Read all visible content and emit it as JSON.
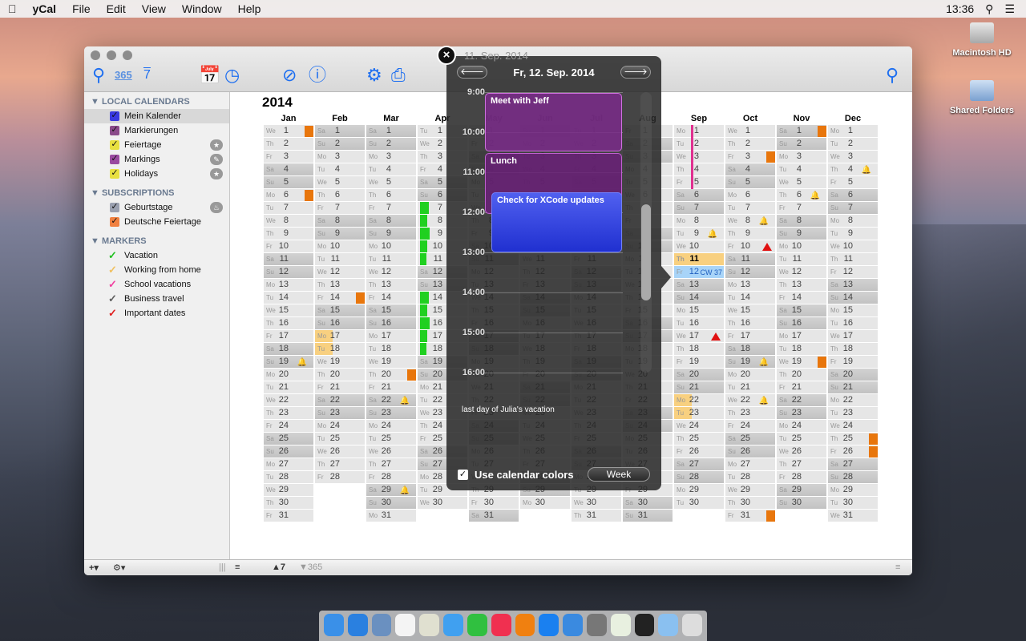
{
  "menubar": {
    "app": "yCal",
    "items": [
      "File",
      "Edit",
      "View",
      "Window",
      "Help"
    ],
    "clock": "13:36"
  },
  "desktop": [
    {
      "label": "Macintosh HD",
      "icon": "hard-drive-icon"
    },
    {
      "label": "Shared Folders",
      "icon": "network-folder-icon"
    }
  ],
  "toolbar": {
    "icons": [
      "location-icon",
      "year-view-365-icon",
      "week-view-7-icon",
      "new-event-icon",
      "new-reminder-icon",
      "edit-icon",
      "info-icon",
      "settings-gear-icon",
      "print-icon",
      "search-icon"
    ],
    "year_label": "365",
    "week_label": "7"
  },
  "sidebar": {
    "sections": [
      {
        "title": "LOCAL CALENDARS",
        "items": [
          {
            "label": "Mein Kalender",
            "color": "#3a3ae0",
            "selected": true
          },
          {
            "label": "Markierungen",
            "color": "#8a4a8a"
          },
          {
            "label": "Feiertage",
            "color": "#e8e040",
            "badge": "star"
          },
          {
            "label": "Markings",
            "color": "#9a4aa0",
            "badge": "pencil"
          },
          {
            "label": "Holidays",
            "color": "#e8e040",
            "badge": "star"
          }
        ]
      },
      {
        "title": "SUBSCRIPTIONS",
        "items": [
          {
            "label": "Geburtstage",
            "color": "#9aa0b0",
            "badge": "cake"
          },
          {
            "label": "Deutsche Feiertage",
            "color": "#f08040"
          }
        ]
      },
      {
        "title": "MARKERS",
        "items": [
          {
            "label": "Vacation",
            "color": "#20c020"
          },
          {
            "label": "Working from home",
            "color": "#f0c060"
          },
          {
            "label": "School vacations",
            "color": "#f040a0"
          },
          {
            "label": "Business travel",
            "color": "#606060"
          },
          {
            "label": "Important dates",
            "color": "#e02020"
          }
        ]
      }
    ]
  },
  "calendar": {
    "year": "2014",
    "months": [
      "Jan",
      "Feb",
      "Mar",
      "Apr",
      "May",
      "Jun",
      "Jul",
      "Aug",
      "Sep",
      "Oct",
      "Nov",
      "Dec"
    ],
    "weekdays": [
      "Su",
      "Mo",
      "Tu",
      "We",
      "Th",
      "Fr",
      "Sa"
    ],
    "cw_label": "CW 37",
    "today": "2014-09-12",
    "markers": [
      {
        "m": 1,
        "d": 1,
        "t": "orange"
      },
      {
        "m": 1,
        "d": 6,
        "t": "orange"
      },
      {
        "m": 1,
        "d": 19,
        "t": "bell"
      },
      {
        "m": 2,
        "d": 14,
        "t": "orange"
      },
      {
        "m": 2,
        "d": 17,
        "t": "wfh"
      },
      {
        "m": 2,
        "d": 18,
        "t": "wfh"
      },
      {
        "m": 3,
        "d": 20,
        "t": "orange"
      },
      {
        "m": 3,
        "d": 22,
        "t": "bell"
      },
      {
        "m": 3,
        "d": 29,
        "t": "bell"
      },
      {
        "m": 4,
        "d": 7,
        "t": "vac"
      },
      {
        "m": 4,
        "d": 8,
        "t": "vac"
      },
      {
        "m": 4,
        "d": 9,
        "t": "vac"
      },
      {
        "m": 4,
        "d": 10,
        "t": "vac"
      },
      {
        "m": 4,
        "d": 11,
        "t": "vac"
      },
      {
        "m": 4,
        "d": 14,
        "t": "vac"
      },
      {
        "m": 4,
        "d": 15,
        "t": "vac"
      },
      {
        "m": 4,
        "d": 16,
        "t": "vac"
      },
      {
        "m": 4,
        "d": 17,
        "t": "vac"
      },
      {
        "m": 4,
        "d": 18,
        "t": "vac"
      },
      {
        "m": 9,
        "d": 9,
        "t": "bell"
      },
      {
        "m": 9,
        "d": 11,
        "t": "wfh"
      },
      {
        "m": 9,
        "d": 17,
        "t": "triangle"
      },
      {
        "m": 9,
        "d": 22,
        "t": "wfh"
      },
      {
        "m": 9,
        "d": 23,
        "t": "wfh"
      },
      {
        "m": 10,
        "d": 3,
        "t": "orange"
      },
      {
        "m": 10,
        "d": 8,
        "t": "bell"
      },
      {
        "m": 10,
        "d": 10,
        "t": "triangle"
      },
      {
        "m": 10,
        "d": 19,
        "t": "bell"
      },
      {
        "m": 10,
        "d": 22,
        "t": "bell"
      },
      {
        "m": 10,
        "d": 31,
        "t": "orange"
      },
      {
        "m": 11,
        "d": 1,
        "t": "orange"
      },
      {
        "m": 11,
        "d": 6,
        "t": "bell"
      },
      {
        "m": 11,
        "d": 19,
        "t": "orange"
      },
      {
        "m": 12,
        "d": 4,
        "t": "bell"
      },
      {
        "m": 12,
        "d": 25,
        "t": "orange"
      },
      {
        "m": 12,
        "d": 26,
        "t": "orange"
      }
    ],
    "page_count": 9,
    "current_page": 5
  },
  "popover": {
    "prev_title": "11. Sep. 2014",
    "title": "Fr, 12. Sep. 2014",
    "hours": [
      "9:00",
      "10:00",
      "11:00",
      "12:00",
      "13:00",
      "14:00",
      "15:00",
      "16:00"
    ],
    "events": [
      {
        "title": "Meet with Jeff",
        "color": "#7a2a8a"
      },
      {
        "title": "Lunch",
        "color": "#6a2078"
      },
      {
        "title": "Check for XCode updates",
        "color": "#2030d0"
      }
    ],
    "all_day_note": "last day of Julia's vacation",
    "use_colors_label": "Use calendar colors",
    "use_colors_checked": true,
    "week_button": "Week"
  },
  "bottombar": {
    "add": "+▾",
    "gear": "⚙▾",
    "week_count": "7",
    "year_count": "365"
  },
  "dock": [
    "finder",
    "safari",
    "preview",
    "calendar",
    "photos",
    "messages",
    "facetime",
    "itunes",
    "ibooks",
    "app-store",
    "xcode",
    "system-preferences",
    "ycal-365",
    "console",
    "downloads-folder",
    "trash"
  ]
}
